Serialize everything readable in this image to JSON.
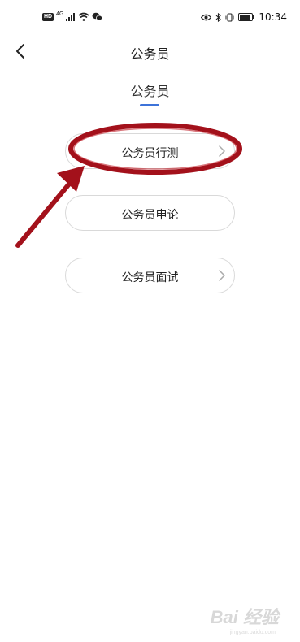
{
  "status_bar": {
    "hd": "HD",
    "network": "4G",
    "time": "10:34"
  },
  "nav": {
    "title": "公务员"
  },
  "section_tab": {
    "label": "公务员"
  },
  "options": [
    {
      "label": "公务员行测",
      "has_chevron": true
    },
    {
      "label": "公务员申论",
      "has_chevron": false
    },
    {
      "label": "公务员面试",
      "has_chevron": true
    }
  ],
  "colors": {
    "accent": "#3d73d9",
    "annotation": "#a3111b"
  },
  "watermark": {
    "text": "Bai 经验",
    "sub": "jingyan.baidu.com"
  }
}
